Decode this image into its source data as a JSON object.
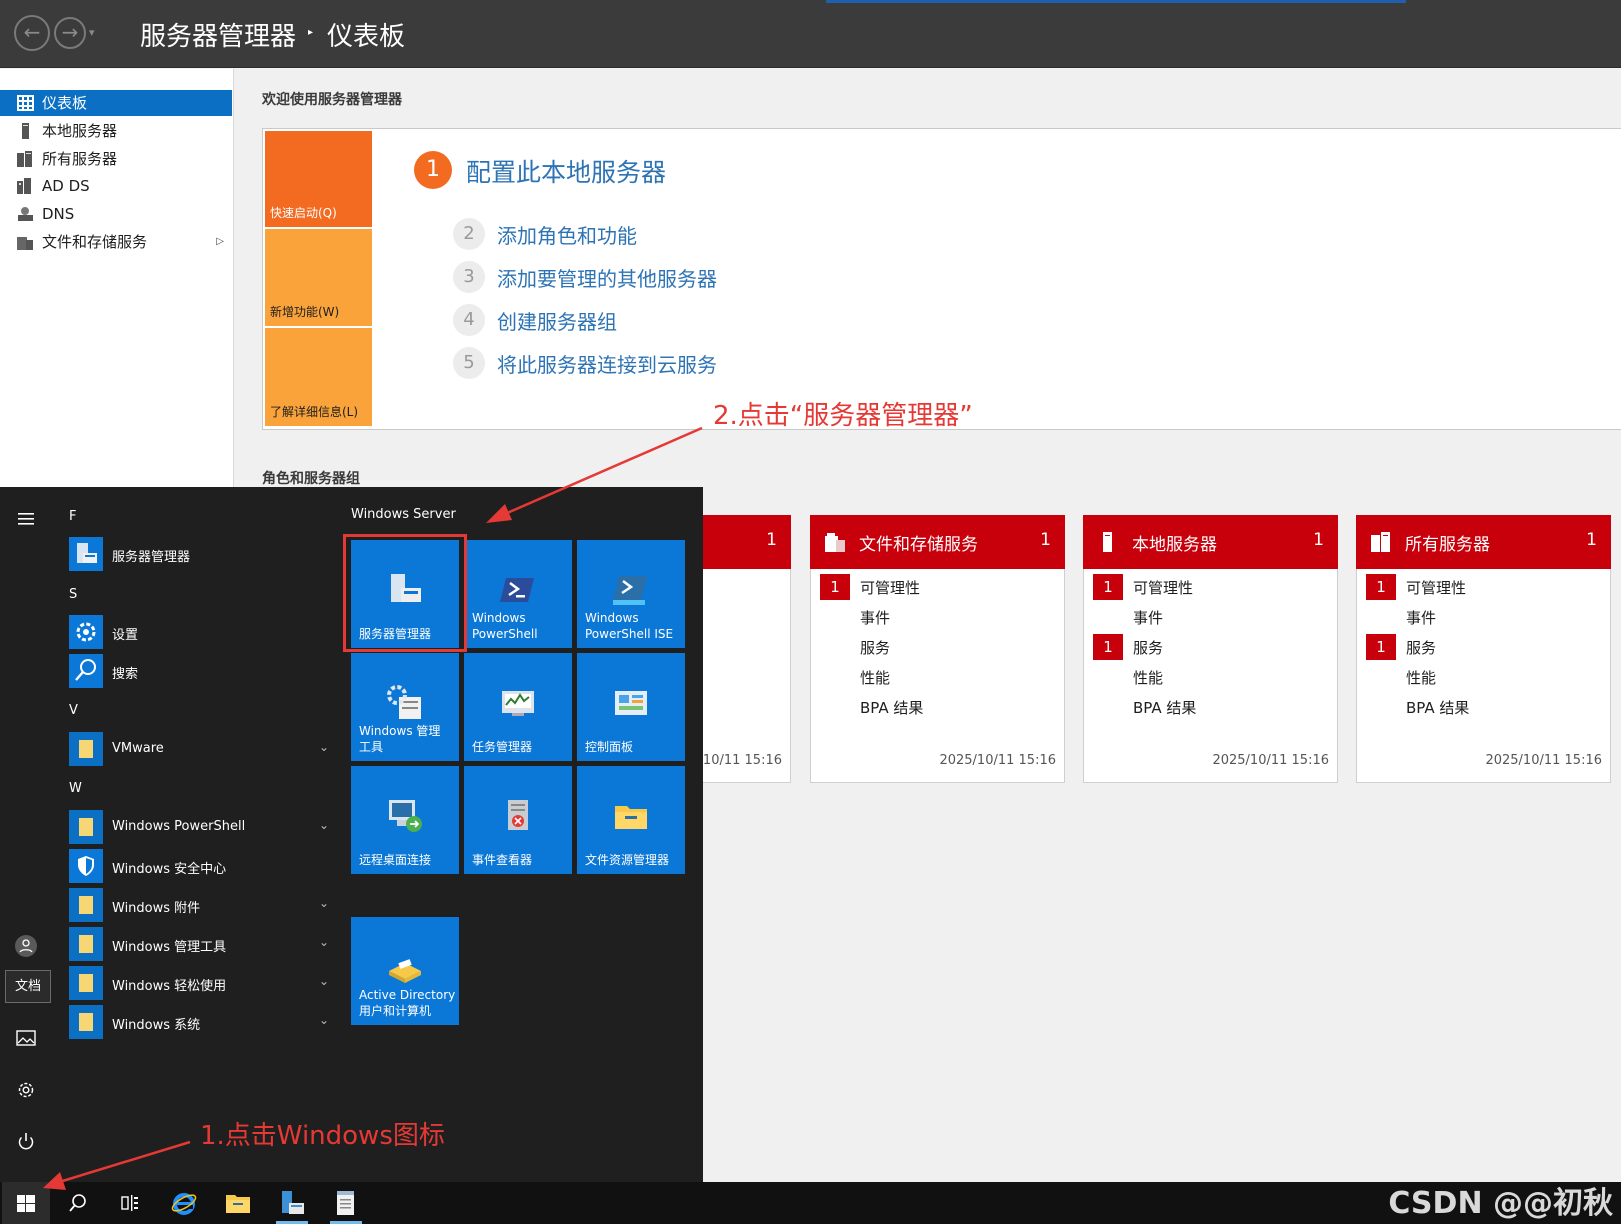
{
  "titlebar": {
    "breadcrumb_root": "服务器管理器",
    "breadcrumb_sep": "▸",
    "breadcrumb_leaf": "仪表板",
    "back_glyph": "←",
    "forward_glyph": "→",
    "dropdown_glyph": "▾"
  },
  "sidebar": {
    "items": [
      {
        "label": "仪表板",
        "icon": "dashboard-icon",
        "selected": true
      },
      {
        "label": "本地服务器",
        "icon": "server-icon"
      },
      {
        "label": "所有服务器",
        "icon": "servers-icon"
      },
      {
        "label": "AD DS",
        "icon": "ad-ds-icon"
      },
      {
        "label": "DNS",
        "icon": "dns-icon"
      },
      {
        "label": "文件和存储服务",
        "icon": "file-storage-icon",
        "has_arrow": true
      }
    ],
    "arrow_glyph": "▷"
  },
  "main": {
    "welcome_heading": "欢迎使用服务器管理器",
    "quickstart": {
      "tiles": [
        "快速启动(Q)",
        "新增功能(W)",
        "了解详细信息(L)"
      ],
      "step1_num": "1",
      "step1_label": "配置此本地服务器",
      "steps": [
        {
          "num": "2",
          "label": "添加角色和功能"
        },
        {
          "num": "3",
          "label": "添加要管理的其他服务器"
        },
        {
          "num": "4",
          "label": "创建服务器组"
        },
        {
          "num": "5",
          "label": "将此服务器连接到云服务"
        }
      ]
    },
    "roles_heading": "角色和服务器组",
    "cards": [
      {
        "title": "",
        "count": "1",
        "time": "/10/11 15:16",
        "rows": []
      },
      {
        "title": "文件和存储服务",
        "count": "1",
        "time": "2025/10/11 15:16",
        "rows": [
          {
            "badge": "1",
            "label": "可管理性"
          },
          {
            "badge": "",
            "label": "事件"
          },
          {
            "badge": "",
            "label": "服务"
          },
          {
            "badge": "",
            "label": "性能"
          },
          {
            "badge": "",
            "label": "BPA 结果"
          }
        ]
      },
      {
        "title": "本地服务器",
        "count": "1",
        "time": "2025/10/11 15:16",
        "rows": [
          {
            "badge": "1",
            "label": "可管理性"
          },
          {
            "badge": "",
            "label": "事件"
          },
          {
            "badge": "1",
            "label": "服务"
          },
          {
            "badge": "",
            "label": "性能"
          },
          {
            "badge": "",
            "label": "BPA 结果"
          }
        ]
      },
      {
        "title": "所有服务器",
        "count": "1",
        "time": "2025/10/11 15:16",
        "rows": [
          {
            "badge": "1",
            "label": "可管理性"
          },
          {
            "badge": "",
            "label": "事件"
          },
          {
            "badge": "1",
            "label": "服务"
          },
          {
            "badge": "",
            "label": "性能"
          },
          {
            "badge": "",
            "label": "BPA 结果"
          }
        ]
      }
    ]
  },
  "startmenu": {
    "rail": {
      "docs_tooltip": "文档"
    },
    "groups": [
      {
        "letter": "F",
        "apps": [
          {
            "label": "服务器管理器",
            "icon": "server-manager-icon"
          }
        ]
      },
      {
        "letter": "S",
        "apps": [
          {
            "label": "设置",
            "icon": "settings-icon"
          },
          {
            "label": "搜索",
            "icon": "search-icon"
          }
        ]
      },
      {
        "letter": "V",
        "apps": [
          {
            "label": "VMware",
            "icon": "folder-icon",
            "expand": true
          }
        ]
      },
      {
        "letter": "W",
        "apps": [
          {
            "label": "Windows PowerShell",
            "icon": "folder-icon",
            "expand": true
          },
          {
            "label": "Windows 安全中心",
            "icon": "shield-icon"
          },
          {
            "label": "Windows 附件",
            "icon": "folder-icon",
            "expand": true
          },
          {
            "label": "Windows 管理工具",
            "icon": "folder-icon",
            "expand": true
          },
          {
            "label": "Windows 轻松使用",
            "icon": "folder-icon",
            "expand": true
          },
          {
            "label": "Windows 系统",
            "icon": "folder-icon",
            "expand": true
          }
        ]
      }
    ],
    "chevron_glyph": "⌄",
    "tiles_group": "Windows Server",
    "tiles": [
      {
        "label": "服务器管理器",
        "icon": "server-manager-icon"
      },
      {
        "label": "Windows\nPowerShell",
        "icon": "powershell-icon"
      },
      {
        "label": "Windows\nPowerShell ISE",
        "icon": "powershell-ise-icon"
      },
      {
        "label": "Windows 管理\n工具",
        "icon": "admin-tools-icon"
      },
      {
        "label": "任务管理器",
        "icon": "task-manager-icon"
      },
      {
        "label": "控制面板",
        "icon": "control-panel-icon"
      },
      {
        "label": "远程桌面连接",
        "icon": "remote-desktop-icon"
      },
      {
        "label": "事件查看器",
        "icon": "event-viewer-icon"
      },
      {
        "label": "文件资源管理器",
        "icon": "file-explorer-icon"
      },
      {
        "label": "Active Directory\n用户和计算机",
        "icon": "active-directory-icon"
      }
    ]
  },
  "taskbar": {
    "items": [
      "start-icon",
      "search-icon",
      "task-view-icon",
      "internet-explorer-icon",
      "file-explorer-icon",
      "server-manager-icon",
      "notepad-icon"
    ]
  },
  "annotations": {
    "step1": "1.点击Windows图标",
    "step2": "2.点击“服务器管理器”"
  },
  "watermark": "CSDN @@初秋",
  "colors": {
    "accent_blue": "#0b78d7",
    "status_red": "#c8000b",
    "quickstart_orange": "#f26b21",
    "annotation_red": "#e53935"
  }
}
